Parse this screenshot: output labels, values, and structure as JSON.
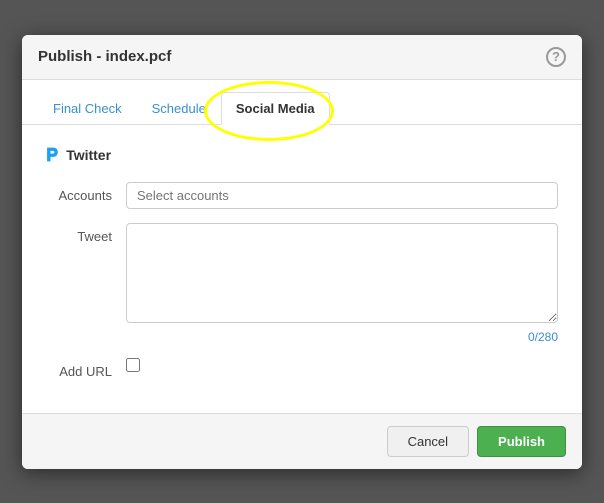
{
  "modal": {
    "title": "Publish - index.pcf",
    "help_label": "?"
  },
  "tabs": {
    "items": [
      {
        "id": "final-check",
        "label": "Final Check",
        "active": false
      },
      {
        "id": "schedule",
        "label": "Schedule",
        "active": false
      },
      {
        "id": "social-media",
        "label": "Social Media",
        "active": true
      }
    ]
  },
  "twitter_section": {
    "icon": "🐦",
    "title": "Twitter"
  },
  "form": {
    "accounts_label": "Accounts",
    "accounts_placeholder": "Select accounts",
    "tweet_label": "Tweet",
    "tweet_value": "",
    "char_count": "0/280",
    "add_url_label": "Add URL"
  },
  "footer": {
    "cancel_label": "Cancel",
    "publish_label": "Publish"
  }
}
